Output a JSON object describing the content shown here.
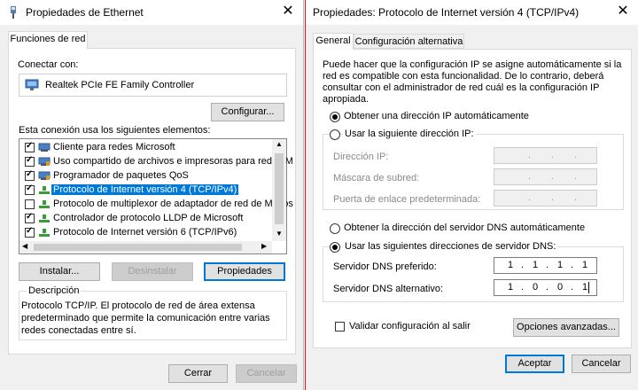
{
  "left_window": {
    "title": "Propiedades de Ethernet",
    "close_glyph": "✕",
    "tab_label": "Funciones de red",
    "connect_label": "Conectar con:",
    "adapter_name": "Realtek PCIe FE Family Controller",
    "configure_button": "Configurar...",
    "elements_label": "Esta conexión usa los siguientes elementos:",
    "items": [
      {
        "label": "Cliente para redes Microsoft",
        "checked": true,
        "icon": "network-client-icon"
      },
      {
        "label": "Uso compartido de archivos e impresoras para redes M",
        "checked": true,
        "icon": "network-service-icon"
      },
      {
        "label": "Programador de paquetes QoS",
        "checked": true,
        "icon": "network-service-icon"
      },
      {
        "label": "Protocolo de Internet versión 4 (TCP/IPv4)",
        "checked": true,
        "icon": "protocol-icon",
        "selected": true
      },
      {
        "label": "Protocolo de multiplexor de adaptador de red de Micros",
        "checked": false,
        "icon": "protocol-icon"
      },
      {
        "label": "Controlador de protocolo LLDP de Microsoft",
        "checked": true,
        "icon": "protocol-icon"
      },
      {
        "label": "Protocolo de Internet versión 6 (TCP/IPv6)",
        "checked": true,
        "icon": "protocol-icon"
      }
    ],
    "install_button": "Instalar...",
    "uninstall_button": "Desinstalar",
    "properties_button": "Propiedades",
    "description_label": "Descripción",
    "description_text_1": "Protocolo TCP/IP. El protocolo de red de área extensa",
    "description_text_2": "predeterminado que permite la comunicación entre varias",
    "description_text_3": "redes conectadas entre sí.",
    "ok_button": "Cerrar",
    "cancel_button": "Cancelar"
  },
  "right_window": {
    "title": "Propiedades: Protocolo de Internet versión 4 (TCP/IPv4)",
    "close_glyph": "✕",
    "tab_general": "General",
    "tab_alternate": "Configuración alternativa",
    "intro_1": "Puede hacer que la configuración IP se asigne automáticamente si la",
    "intro_2": "red es compatible con esta funcionalidad. De lo contrario, deberá",
    "intro_3": "consultar con el administrador de red cuál es la configuración IP",
    "intro_4": "apropiada.",
    "radio_auto_ip": "Obtener una dirección IP automáticamente",
    "radio_manual_ip": "Usar la siguiente dirección IP:",
    "ip_address_label": "Dirección IP:",
    "subnet_label": "Máscara de subred:",
    "gateway_label": "Puerta de enlace predeterminada:",
    "radio_auto_dns": "Obtener la dirección del servidor DNS automáticamente",
    "radio_manual_dns": "Usar las siguientes direcciones de servidor DNS:",
    "dns_preferred_label": "Servidor DNS preferido:",
    "dns_alternate_label": "Servidor DNS alternativo:",
    "dns_preferred": [
      "1",
      "1",
      "1",
      "1"
    ],
    "dns_alternate": [
      "1",
      "0",
      "0",
      "1"
    ],
    "validate_label": "Validar configuración al salir",
    "advanced_button": "Opciones avanzadas...",
    "ok_button": "Aceptar",
    "cancel_button": "Cancelar",
    "dot": "."
  },
  "colors": {
    "accent": "#0078d7",
    "title_border_right": "#e81123"
  }
}
